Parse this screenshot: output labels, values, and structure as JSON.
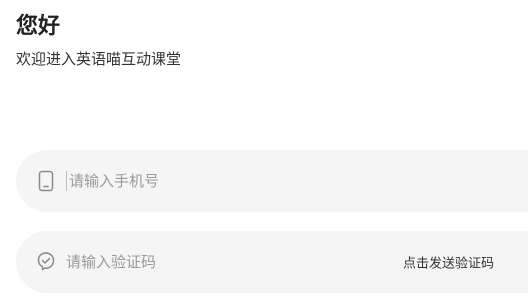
{
  "header": {
    "title": "您好",
    "subtitle": "欢迎进入英语喵互动课堂"
  },
  "phone_field": {
    "placeholder": "请输入手机号",
    "value": "",
    "icon": "phone-icon"
  },
  "code_field": {
    "placeholder": "请输入验证码",
    "value": "",
    "icon": "shield-check-icon",
    "send_code_label": "点击发送验证码"
  },
  "colors": {
    "field_background": "#f5f5f5",
    "placeholder": "#9a9a9a",
    "title": "#222222"
  }
}
